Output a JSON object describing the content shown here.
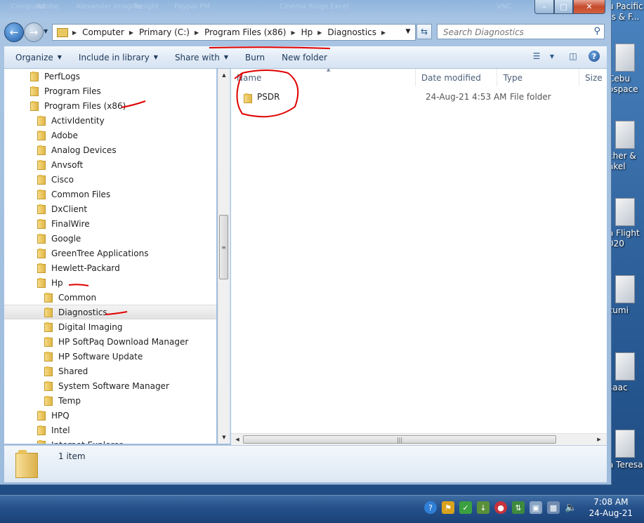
{
  "window": {
    "ghost_titles": [
      "Computer",
      "Adobe",
      "Alexander Imagine",
      "Tonight",
      "Paypal PM",
      "Cinema Ridge",
      "Excel",
      "VNC"
    ],
    "caption": {
      "minimize": "–",
      "maximize": "□",
      "close": "✕"
    }
  },
  "address": {
    "crumbs": [
      "Computer",
      "Primary (C:)",
      "Program Files (x86)",
      "Hp",
      "Diagnostics"
    ]
  },
  "search": {
    "placeholder": "Search Diagnostics"
  },
  "toolbar": {
    "organize": "Organize",
    "include_in_library": "Include in library",
    "share_with": "Share with",
    "burn": "Burn",
    "new_folder": "New folder"
  },
  "tree": [
    {
      "label": "PerfLogs",
      "level": 0
    },
    {
      "label": "Program Files",
      "level": 0
    },
    {
      "label": "Program Files (x86)",
      "level": 0
    },
    {
      "label": "ActivIdentity",
      "level": 1
    },
    {
      "label": "Adobe",
      "level": 1
    },
    {
      "label": "Analog Devices",
      "level": 1
    },
    {
      "label": "Anvsoft",
      "level": 1
    },
    {
      "label": "Cisco",
      "level": 1
    },
    {
      "label": "Common Files",
      "level": 1
    },
    {
      "label": "DxClient",
      "level": 1
    },
    {
      "label": "FinalWire",
      "level": 1
    },
    {
      "label": "Google",
      "level": 1
    },
    {
      "label": "GreenTree Applications",
      "level": 1
    },
    {
      "label": "Hewlett-Packard",
      "level": 1
    },
    {
      "label": "Hp",
      "level": 1
    },
    {
      "label": "Common",
      "level": 2
    },
    {
      "label": "Diagnostics",
      "level": 2,
      "selected": true
    },
    {
      "label": "Digital Imaging",
      "level": 2
    },
    {
      "label": "HP SoftPaq Download Manager",
      "level": 2
    },
    {
      "label": "HP Software Update",
      "level": 2
    },
    {
      "label": "Shared",
      "level": 2
    },
    {
      "label": "System Software Manager",
      "level": 2
    },
    {
      "label": "Temp",
      "level": 2
    },
    {
      "label": "HPQ",
      "level": 1
    },
    {
      "label": "Intel",
      "level": 1
    },
    {
      "label": "Internet Explorer",
      "level": 1
    }
  ],
  "columns": {
    "name": "Name",
    "date_modified": "Date modified",
    "type": "Type",
    "size": "Size"
  },
  "files": [
    {
      "name": "PSDR",
      "date_modified": "24-Aug-21 4:53 AM",
      "type": "File folder"
    }
  ],
  "details": {
    "item_count": "1 item"
  },
  "desktop_icons": [
    {
      "lines": [
        "u Pacific",
        "ts & F..."
      ]
    },
    {
      "lines": [
        "Cebu",
        "ospace"
      ]
    },
    {
      "lines": [
        "cher &",
        "akel"
      ]
    },
    {
      "lines": [
        "a Flight",
        "020"
      ]
    },
    {
      "lines": [
        "zumi"
      ]
    },
    {
      "lines": [
        "saac"
      ]
    },
    {
      "lines": [
        "a Teresa"
      ]
    }
  ],
  "taskbar": {
    "time": "7:08 AM",
    "date": "24-Aug-21"
  },
  "colors": {
    "annotation_red": "#e00000",
    "selection": "#e6e6e6",
    "toolbar_text": "#1e395b"
  }
}
